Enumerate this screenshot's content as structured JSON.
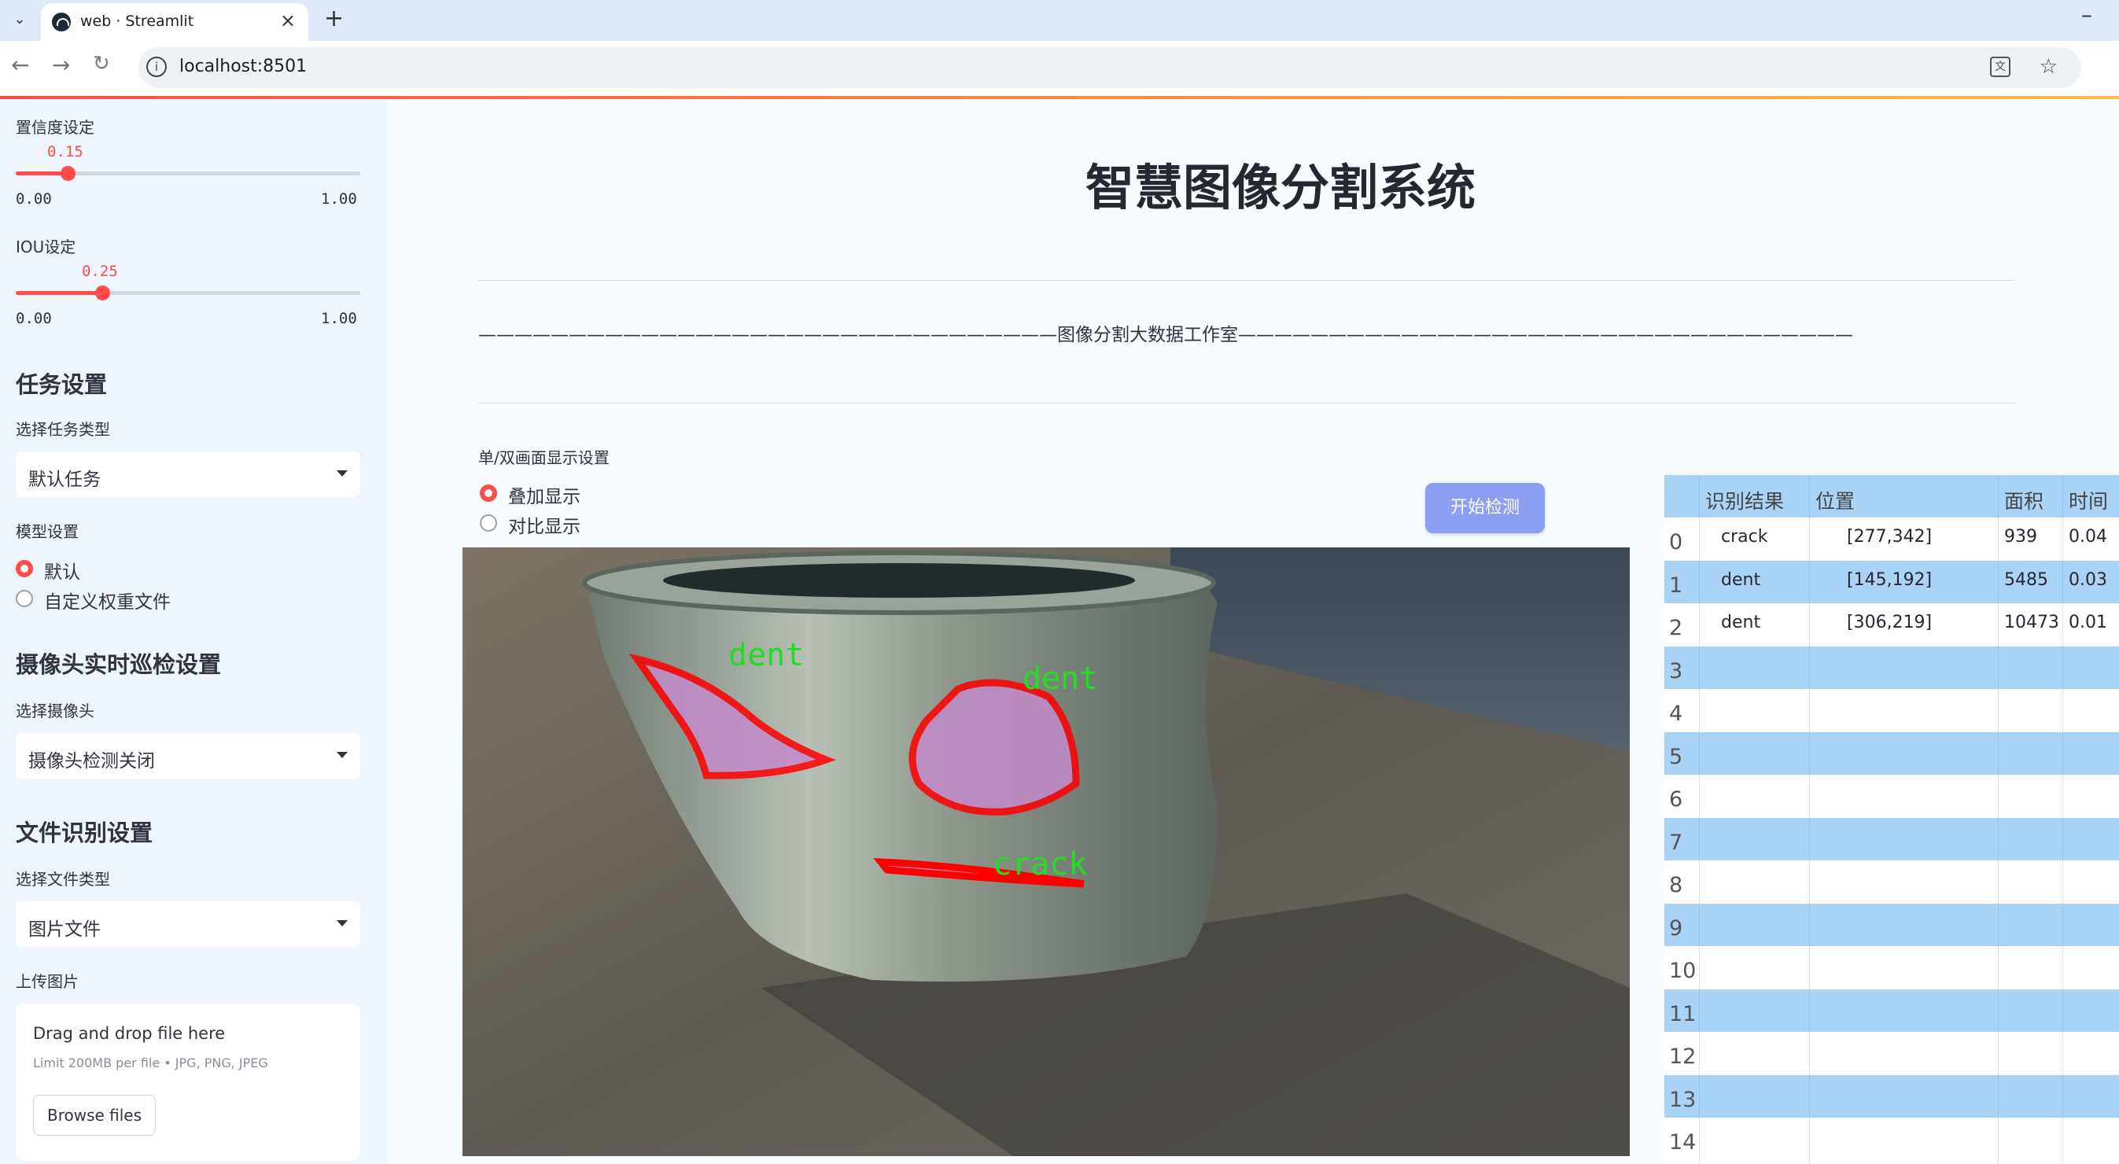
{
  "browser": {
    "tab_title": "web · Streamlit",
    "url": "localhost:8501"
  },
  "sidebar": {
    "confidence": {
      "label": "置信度设定",
      "value": "0.15",
      "min": "0.00",
      "max": "1.00",
      "fraction": 0.15
    },
    "iou": {
      "label": "IOU设定",
      "value": "0.25",
      "min": "0.00",
      "max": "1.00",
      "fraction": 0.25
    },
    "task_heading": "任务设置",
    "task_type_label": "选择任务类型",
    "task_type_value": "默认任务",
    "model_label": "模型设置",
    "model_options": [
      "默认",
      "自定义权重文件"
    ],
    "camera_heading": "摄像头实时巡检设置",
    "camera_label": "选择摄像头",
    "camera_value": "摄像头检测关闭",
    "file_heading": "文件识别设置",
    "file_type_label": "选择文件类型",
    "file_type_value": "图片文件",
    "upload_label": "上传图片",
    "upload_title": "Drag and drop file here",
    "upload_limit": "Limit 200MB per file • JPG, PNG, JPEG",
    "browse_label": "Browse files"
  },
  "main": {
    "title": "智慧图像分割系统",
    "banner": "————————————————————————————————图像分割大数据工作室——————————————————————————————————",
    "display_label": "单/双画面显示设置",
    "display_options": [
      "叠加显示",
      "对比显示"
    ],
    "start_button": "开始检测",
    "detections": [
      "dent",
      "dent",
      "crack"
    ]
  },
  "table": {
    "headers": [
      "识别结果",
      "位置",
      "面积",
      "时间"
    ],
    "rows": [
      {
        "idx": "0",
        "label": "crack",
        "pos": "[277,342]",
        "area": "939",
        "time": "0.04"
      },
      {
        "idx": "1",
        "label": "dent",
        "pos": "[145,192]",
        "area": "5485",
        "time": "0.03"
      },
      {
        "idx": "2",
        "label": "dent",
        "pos": "[306,219]",
        "area": "10473",
        "time": "0.01"
      },
      {
        "idx": "3"
      },
      {
        "idx": "4"
      },
      {
        "idx": "5"
      },
      {
        "idx": "6"
      },
      {
        "idx": "7"
      },
      {
        "idx": "8"
      },
      {
        "idx": "9"
      },
      {
        "idx": "10"
      },
      {
        "idx": "11"
      },
      {
        "idx": "12"
      },
      {
        "idx": "13"
      },
      {
        "idx": "14"
      }
    ]
  },
  "colors": {
    "accent": "#ff4b4b",
    "button": "#8c9ff3",
    "table_stripe": "#aad4f5",
    "mask_outline": "#ff0000",
    "label_text": "#22dd22"
  }
}
